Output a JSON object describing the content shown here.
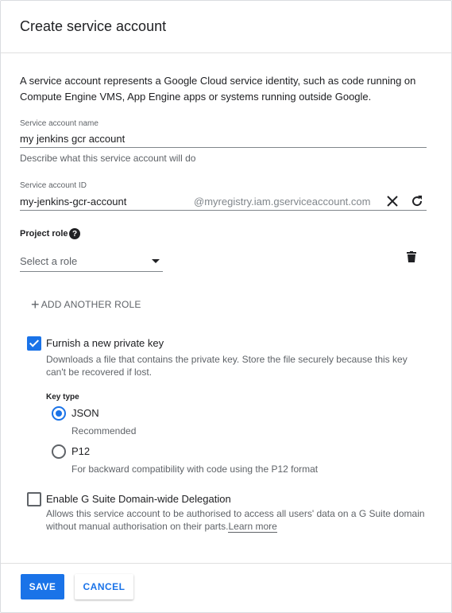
{
  "dialog": {
    "title": "Create service account",
    "description": "A service account represents a Google Cloud service identity, such as code running on Compute Engine VMS, App Engine apps or systems running outside Google."
  },
  "service_account_name": {
    "label": "Service account name",
    "value": "my jenkins gcr account",
    "hint": "Describe what this service account will do"
  },
  "service_account_id": {
    "label": "Service account ID",
    "value": "my-jenkins-gcr-account",
    "suffix": "@myregistry.iam.gserviceaccount.com"
  },
  "project_role": {
    "label": "Project role",
    "help_icon": "?",
    "select_placeholder": "Select a role",
    "add_role_label": "ADD ANOTHER ROLE"
  },
  "private_key": {
    "label": "Furnish a new private key",
    "checked": true,
    "description": "Downloads a file that contains the private key. Store the file securely because this key can't be recovered if lost.",
    "key_type_label": "Key type",
    "options": [
      {
        "label": "JSON",
        "sub": "Recommended",
        "selected": true
      },
      {
        "label": "P12",
        "sub": "For backward compatibility with code using the P12 format",
        "selected": false
      }
    ]
  },
  "delegation": {
    "label": "Enable G Suite Domain-wide Delegation",
    "checked": false,
    "description": "Allows this service account to be authorised to access all users' data on a G Suite domain without manual authorisation on their parts.",
    "link": "Learn more"
  },
  "footer": {
    "save_label": "SAVE",
    "cancel_label": "CANCEL"
  },
  "colors": {
    "accent": "#1a73e8",
    "text": "#202124",
    "secondary_text": "#5f6368"
  }
}
